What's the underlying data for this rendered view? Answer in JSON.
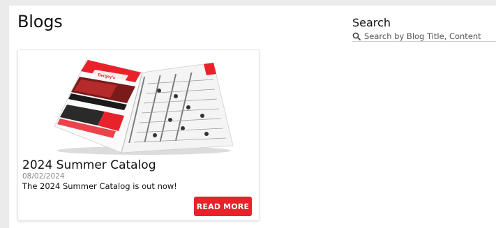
{
  "page": {
    "title": "Blogs"
  },
  "search": {
    "label": "Search",
    "placeholder": "Search by Blog Title, Content",
    "value": ""
  },
  "posts": [
    {
      "title": "2024 Summer Catalog",
      "date": "08/02/2024",
      "excerpt": "The 2024 Summer Catalog is out now!",
      "button_label": "READ MORE",
      "image_icon": "catalog-image"
    }
  ],
  "colors": {
    "accent": "#e8222b",
    "background": "#ebebeb",
    "card": "#ffffff"
  }
}
